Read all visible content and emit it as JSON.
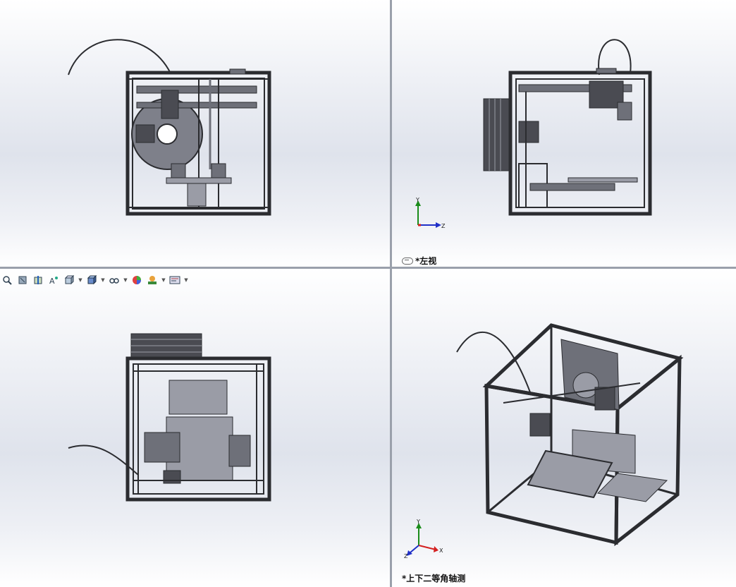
{
  "viewports": {
    "top_left": {
      "label": ""
    },
    "top_right": {
      "label": "*左视",
      "view_icon": "link-icon"
    },
    "bottom_left": {
      "label": ""
    },
    "bottom_right": {
      "label": "*上下二等角轴测"
    }
  },
  "triad": {
    "axis_x": "X",
    "axis_y": "Y",
    "axis_z": "Z"
  },
  "heads_up_toolbar": [
    {
      "name": "zoom-to-area-icon"
    },
    {
      "name": "previous-view-icon"
    },
    {
      "name": "section-view-icon"
    },
    {
      "name": "dynamic-annotation-icon"
    },
    {
      "name": "view-orientation-icon",
      "has_dropdown": true
    },
    {
      "name": "display-style-icon",
      "has_dropdown": true
    },
    {
      "name": "hide-show-items-icon",
      "has_dropdown": true
    },
    {
      "name": "edit-appearance-icon"
    },
    {
      "name": "apply-scene-icon",
      "has_dropdown": true
    },
    {
      "name": "view-settings-icon",
      "has_dropdown": true
    }
  ],
  "colors": {
    "model_dark": "#2b2c30",
    "model_mid": "#6e7079",
    "model_light": "#9a9ca6",
    "divider": "#9aa0ab",
    "axis_x": "#d42020",
    "axis_y": "#1a8c1a",
    "axis_z": "#2030c8"
  }
}
